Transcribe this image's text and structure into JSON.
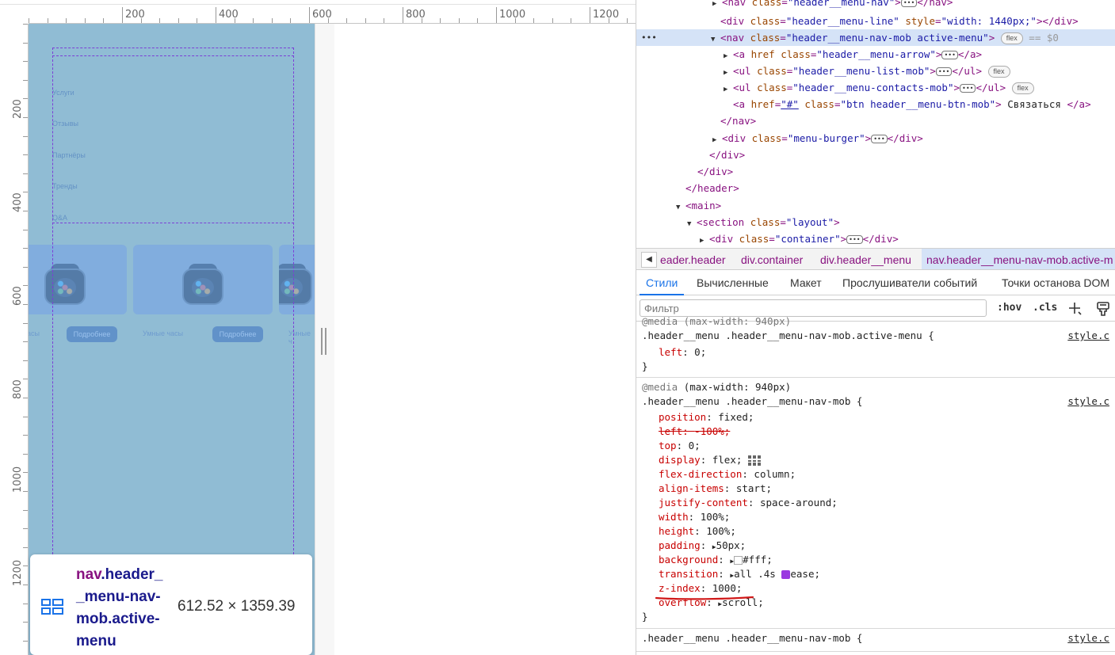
{
  "ruler": {
    "top_labels": [
      "200",
      "400",
      "600",
      "800",
      "1000",
      "1200"
    ],
    "left_labels": [
      "200",
      "400",
      "600",
      "800",
      "1000",
      "1200"
    ]
  },
  "page_menu": {
    "items": [
      "Услуги",
      "Отзывы",
      "Партнёры",
      "Тренды",
      "Q&A"
    ]
  },
  "products": {
    "caption_left": "асы",
    "caption_mid": "Умные часы",
    "caption_right": "Умные ч",
    "more_label": "Подробнее"
  },
  "tooltip": {
    "tag": "nav",
    "classes": ".header__menu-nav-mob.active-menu",
    "size": "612.52 × 1359.39"
  },
  "dom_tree": {
    "line1": {
      "tag_open": "<nav ",
      "attr": "class",
      "val": "\"header__menu-nav\"",
      "close": ">",
      "end": "</nav>"
    },
    "line2": {
      "tag_open": "<div ",
      "attr": "class",
      "val": "\"header__menu-line\"",
      "attr2": "style",
      "val2": "\"width: 1440px;\"",
      "end": "></div>"
    },
    "line3": {
      "tag_open": "<nav ",
      "attr": "class",
      "val": "\"header__menu-nav-mob active-menu\"",
      "close": ">",
      "pill": "flex",
      "dollar": "== $0"
    },
    "line4": {
      "tag_open": "<a ",
      "attr": "href",
      "attr2": "class",
      "val2": "\"header__menu-arrow\"",
      "close": ">",
      "end": "</a>"
    },
    "line5": {
      "tag_open": "<ul ",
      "attr": "class",
      "val": "\"header__menu-list-mob\"",
      "close": ">",
      "end": "</ul>",
      "pill": "flex"
    },
    "line6": {
      "tag_open": "<ul ",
      "attr": "class",
      "val": "\"header__menu-contacts-mob\"",
      "close": ">",
      "end": "</ul>",
      "pill": "flex"
    },
    "line7": {
      "tag_open": "<a ",
      "attr": "href",
      "val": "\"#\"",
      "attr2": "class",
      "val2": "\"btn header__menu-btn-mob\"",
      "close": ">",
      "text": " Связаться ",
      "end": "</a>"
    },
    "line8": "</nav>",
    "line9": {
      "tag_open": "<div ",
      "attr": "class",
      "val": "\"menu-burger\"",
      "close": ">",
      "end": "</div>"
    },
    "line10": "</div>",
    "line11": "</div>",
    "line12": "</header>",
    "line13": "<main>",
    "line14": {
      "tag_open": "<section ",
      "attr": "class",
      "val": "\"layout\"",
      "close": ">"
    },
    "line15": {
      "tag_open": "<div ",
      "attr": "class",
      "val": "\"container\"",
      "close": ">",
      "end": "</div>"
    }
  },
  "breadcrumbs": [
    "eader.header",
    "div.container",
    "div.header__menu",
    "nav.header__menu-nav-mob.active-m"
  ],
  "tabs": [
    "Стили",
    "Вычисленные",
    "Макет",
    "Прослушиватели событий",
    "Точки останова DOM"
  ],
  "filter": {
    "placeholder": "Фильтр",
    "hov": ":hov",
    "cls": ".cls"
  },
  "rules": {
    "media_top": "@media (max-width: 940px)",
    "rule1": {
      "selector": ".header__menu .header__menu-nav-mob.active-menu {",
      "source": "style.c",
      "decls": [
        {
          "prop": "left",
          "value": "0;"
        }
      ],
      "close": "}"
    },
    "media2": "@media",
    "media2_cond": "(max-width: 940px)",
    "rule2": {
      "selector": ".header__menu .header__menu-nav-mob {",
      "source": "style.c",
      "decls": [
        {
          "prop": "position",
          "value": "fixed;"
        },
        {
          "prop": "left",
          "value": "-100%;",
          "overridden": true
        },
        {
          "prop": "top",
          "value": "0;"
        },
        {
          "prop": "display",
          "value": "flex;"
        },
        {
          "prop": "flex-direction",
          "value": "column;"
        },
        {
          "prop": "align-items",
          "value": "start;"
        },
        {
          "prop": "justify-content",
          "value": "space-around;"
        },
        {
          "prop": "width",
          "value": "100%;"
        },
        {
          "prop": "height",
          "value": "100%;"
        },
        {
          "prop": "padding",
          "value": "50px;"
        },
        {
          "prop": "background",
          "value": "#fff;"
        },
        {
          "prop": "transition",
          "value": "all .4s",
          "value2": "ease;"
        },
        {
          "prop": "z-index",
          "value": "1000;"
        },
        {
          "prop": "overflow",
          "value": "scroll;"
        }
      ],
      "close": "}"
    },
    "rule3": {
      "selector": ".header__menu .header__menu-nav-mob {",
      "source": "style.c"
    }
  }
}
